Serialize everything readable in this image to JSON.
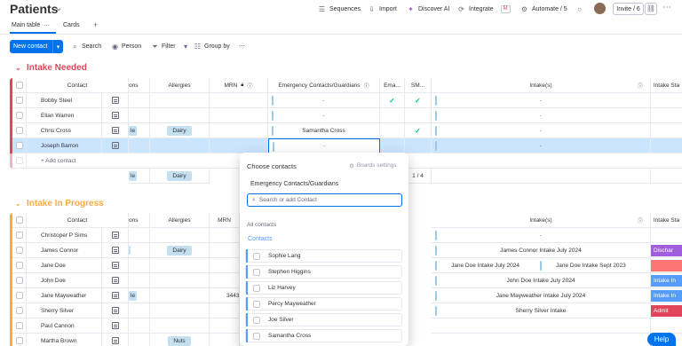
{
  "header": {
    "title": "Patients",
    "sequences": "Sequences",
    "import": "Import",
    "discover_ai": "Discover AI",
    "integrate": "Integrate",
    "automate": "Automate / 5",
    "invite": "Invite / 6"
  },
  "tabs": [
    "Main table",
    "Cards"
  ],
  "toolbar": {
    "new_contact": "New contact",
    "search": "Search",
    "person": "Person",
    "filter": "Filter",
    "group_by": "Group by"
  },
  "columns": {
    "contact": "Contact",
    "ons": "ons",
    "allergies": "Allergies",
    "mrn": "MRN",
    "emergency": "Emergency Contacts/Guardians",
    "email": "Ema...",
    "sms": "SM...",
    "intakes": "Intake(s)",
    "intake_status": "Intake Sta"
  },
  "group1": {
    "title": "Intake Needed",
    "color": "#e2445c",
    "rows": [
      {
        "name": "Bobby Steel",
        "ons": "",
        "allergies": "",
        "emergency": "-",
        "email": "✓",
        "sms": "✓",
        "intakes": "-"
      },
      {
        "name": "Elian Warren",
        "ons": "",
        "allergies": "",
        "emergency": "-",
        "email": "",
        "sms": "",
        "intakes": "-"
      },
      {
        "name": "Chris Cross",
        "ons": "le",
        "allergies": "Dairy",
        "emergency": "Samantha Cross",
        "email": "",
        "sms": "✓",
        "intakes": "-"
      },
      {
        "name": "Joseph Barron",
        "ons": "",
        "allergies": "",
        "emergency": "-",
        "email": "",
        "sms": "",
        "intakes": "-"
      }
    ],
    "add_label": "+ Add contact",
    "summary": {
      "ons": "le",
      "allergies": "Dairy",
      "sms_count": "1 / 4"
    }
  },
  "group2": {
    "title": "Intake In Progress",
    "color": "#fdab3d",
    "rows": [
      {
        "name": "Christoper P Sims",
        "ons": "",
        "allergies": "",
        "mrn": "",
        "intakes": [
          "-"
        ],
        "status": "",
        "status_color": ""
      },
      {
        "name": "James Connor",
        "ons": "",
        "allergies": "Dairy",
        "mrn": "",
        "intakes": [
          "James Connor Intake July 2024"
        ],
        "status": "Dischar",
        "status_color": "#a25ddc"
      },
      {
        "name": "Jane Doe",
        "ons": "",
        "allergies": "",
        "mrn": "",
        "intakes": [
          "Jane Doe Intake July 2024",
          "Jane Doe Intake Sept 2023"
        ],
        "status": "",
        "status_color": "#ff7575"
      },
      {
        "name": "John Doe",
        "ons": "",
        "allergies": "",
        "mrn": "",
        "intakes": [
          "John Doe Intake July 2024"
        ],
        "status": "Intake In",
        "status_color": "#579bfc"
      },
      {
        "name": "Jane Mayweather",
        "ons": "le",
        "allergies": "",
        "mrn": "3443",
        "intakes": [
          "Jane Mayweather Intake July 2024"
        ],
        "status": "Intake In",
        "status_color": "#579bfc"
      },
      {
        "name": "Sherry Silver",
        "ons": "",
        "allergies": "",
        "mrn": "",
        "intakes": [
          "Sherry Silver Intake"
        ],
        "status": "Admit",
        "status_color": "#e2445c"
      },
      {
        "name": "Paul Cannon",
        "ons": "",
        "allergies": "",
        "mrn": "",
        "intakes": [],
        "status": "",
        "status_color": ""
      },
      {
        "name": "Martha Brown",
        "ons": "",
        "allergies": "Nuts",
        "mrn": "",
        "intakes": [],
        "status": "",
        "status_color": ""
      }
    ]
  },
  "dropdown": {
    "title": "Choose contacts",
    "settings": "Boards settings",
    "column_name": "Emergency Contacts/Guardians",
    "search_placeholder": "Search or add Contact",
    "all_contacts": "All contacts",
    "contacts_label": "Contacts",
    "options": [
      "Sophie Lang",
      "Stephen Higgins",
      "Liz Harvey",
      "Percy Mayweather",
      "Joe Silver",
      "Samantha Cross"
    ]
  },
  "help": "Help"
}
